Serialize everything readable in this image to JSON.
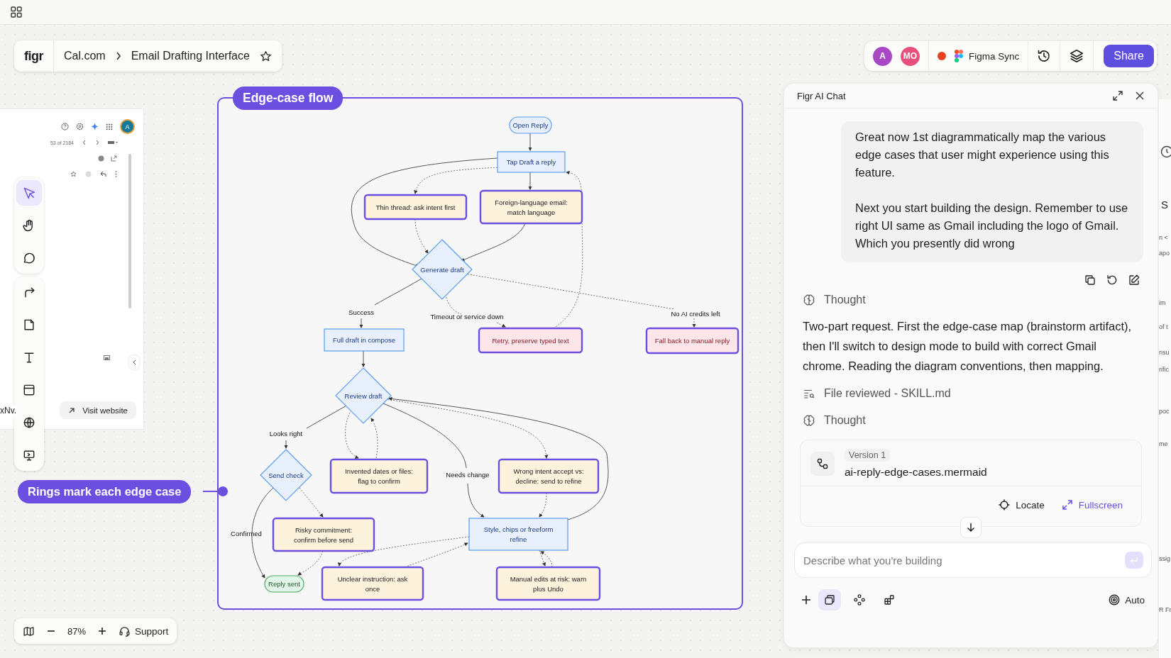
{
  "breadcrumb": {
    "logo": "figr",
    "items": [
      "Cal.com",
      "Email Drafting Interface"
    ]
  },
  "collaborators": [
    {
      "initials": "A",
      "color": "#a848c4"
    },
    {
      "initials": "MO",
      "color": "#e8507c"
    }
  ],
  "sync": {
    "label": "Figma Sync"
  },
  "share_button": "Share",
  "preview": {
    "pager": "53 of 2184",
    "avatar": "A",
    "fragment": "xNv.",
    "visit_button": "Visit website"
  },
  "tool_groups": [
    [
      {
        "kind": "select",
        "selected": true
      },
      {
        "kind": "hand",
        "selected": false
      },
      {
        "kind": "comment",
        "selected": false
      }
    ],
    [
      {
        "kind": "connector",
        "selected": false
      },
      {
        "kind": "note",
        "selected": false
      },
      {
        "kind": "text",
        "selected": false
      },
      {
        "kind": "frame",
        "selected": false
      },
      {
        "kind": "web",
        "selected": false
      },
      {
        "kind": "screen",
        "selected": false
      }
    ]
  ],
  "frame": {
    "title": "Edge-case flow",
    "nodes": [
      {
        "kind": "start",
        "lines": [
          "Open Reply"
        ]
      },
      {
        "kind": "step",
        "lines": [
          "Tap Draft a reply"
        ]
      },
      {
        "kind": "edge_case",
        "lines": [
          "Thin thread: ask intent first"
        ]
      },
      {
        "kind": "edge_case",
        "lines": [
          "Foreign-language email:",
          "match language"
        ]
      },
      {
        "kind": "decision",
        "lines": [
          "Generate draft"
        ]
      },
      {
        "kind": "step",
        "lines": [
          "Full draft in compose"
        ]
      },
      {
        "kind": "error",
        "lines": [
          "Retry, preserve typed text"
        ]
      },
      {
        "kind": "error",
        "lines": [
          "Fall back to manual reply"
        ]
      },
      {
        "kind": "decision",
        "lines": [
          "Review draft"
        ]
      },
      {
        "kind": "decision",
        "lines": [
          "Send check"
        ]
      },
      {
        "kind": "edge_case",
        "lines": [
          "Invented dates or files:",
          "flag to confirm"
        ]
      },
      {
        "kind": "edge_case",
        "lines": [
          "Wrong intent accept vs:",
          "decline: send to refine"
        ]
      },
      {
        "kind": "edge_case",
        "lines": [
          "Risky commitment:",
          "confirm before send"
        ]
      },
      {
        "kind": "step",
        "lines": [
          "Style, chips or freeform",
          "refine"
        ]
      },
      {
        "kind": "end",
        "lines": [
          "Reply sent"
        ]
      },
      {
        "kind": "edge_case",
        "lines": [
          "Unclear instruction: ask",
          "once"
        ]
      },
      {
        "kind": "edge_case",
        "lines": [
          "Manual edits at risk: warn",
          "plus Undo"
        ]
      }
    ],
    "edge_labels": [
      "Success",
      "Timeout or service down",
      "No AI credits left",
      "Looks right",
      "Needs change",
      "Confirmed"
    ]
  },
  "annotation": {
    "label": "Rings mark each edge case"
  },
  "zoom_bar": {
    "zoom": "87%",
    "support": "Support"
  },
  "chat": {
    "title": "Figr AI Chat",
    "user_message": [
      "Great now 1st diagrammatically map the various edge cases that user might experience using this feature.",
      "Next you start building the design. Remember to use right UI same as Gmail including the logo of Gmail. Which you presently did wrong"
    ],
    "steps": [
      {
        "kind": "thought",
        "text": "Thought"
      },
      {
        "kind": "paragraph",
        "text": "Two-part request. First the edge-case map (brainstorm artifact), then I'll switch to design mode to build with correct Gmail chrome. Reading the diagram conventions, then mapping."
      },
      {
        "kind": "file",
        "text": "File reviewed - SKILL.md"
      },
      {
        "kind": "thought",
        "text": "Thought"
      }
    ],
    "artifact": {
      "version": "Version 1",
      "filename": "ai-reply-edge-cases.mermaid",
      "actions": [
        {
          "kind": "locate",
          "label": "Locate"
        },
        {
          "kind": "fullscreen",
          "label": "Fullscreen"
        }
      ]
    },
    "input": {
      "placeholder": "Describe what you're building"
    },
    "modes": [
      {
        "kind": "pages",
        "selected": true
      },
      {
        "kind": "components",
        "selected": false
      },
      {
        "kind": "blocks",
        "selected": false
      }
    ],
    "model": "Auto"
  },
  "edge_panel": {
    "fragments": [
      "S",
      "n <",
      "apo",
      "im",
      "of t",
      "nsu",
      "rific",
      "poc",
      "me",
      "ssig",
      "R Fr"
    ]
  }
}
